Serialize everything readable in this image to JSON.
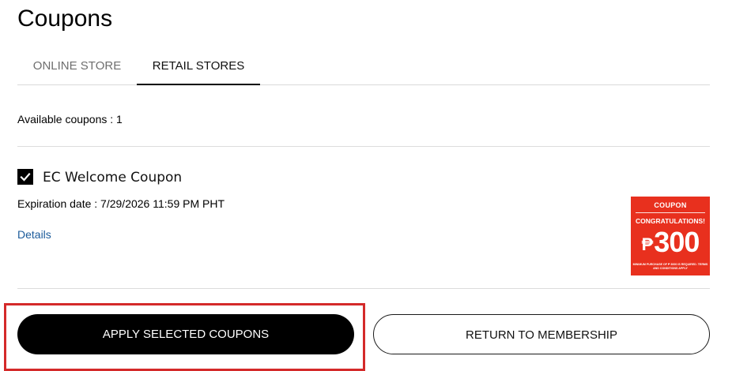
{
  "page": {
    "title": "Coupons"
  },
  "tabs": [
    {
      "label": "ONLINE STORE",
      "active": false
    },
    {
      "label": "RETAIL STORES",
      "active": true
    }
  ],
  "summary": {
    "available_text": "Available coupons : 1"
  },
  "coupon": {
    "checked": true,
    "name": "EC Welcome Coupon",
    "expiration_text": "Expiration date : 7/29/2026 11:59 PM PHT",
    "details_label": "Details",
    "image": {
      "header": "COUPON",
      "congrats": "CONGRATULATIONS!",
      "currency": "₱",
      "amount": "300",
      "fine_print": "MINIMUM PURCHASE OF ₱ 3000 IS REQUIRED. TERMS AND CONDITIONS APPLY",
      "background_color": "#e8301e"
    }
  },
  "actions": {
    "apply_label": "APPLY SELECTED COUPONS",
    "return_label": "RETURN TO MEMBERSHIP"
  },
  "colors": {
    "link": "#1a5a9a",
    "highlight": "#d42a2a",
    "primary_button": "#000000"
  },
  "icons": {
    "checkbox": "checkmark-icon"
  }
}
